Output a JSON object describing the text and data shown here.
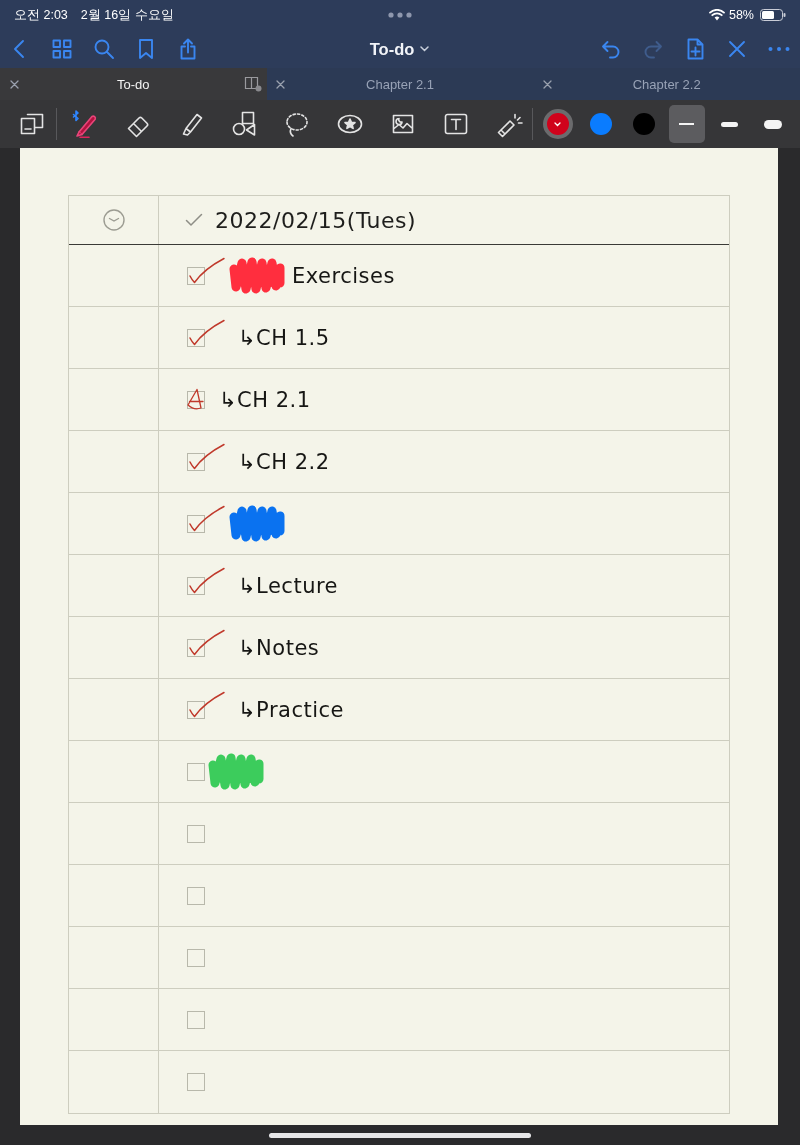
{
  "status_bar": {
    "time": "오전 2:03",
    "date": "2월 16일 수요일",
    "battery": "58%"
  },
  "nav_bar": {
    "left_buttons": [
      {
        "kind": "back",
        "disabled": false
      },
      {
        "kind": "grid",
        "disabled": false
      },
      {
        "kind": "search",
        "disabled": false
      },
      {
        "kind": "bookmark",
        "disabled": false
      },
      {
        "kind": "share",
        "disabled": false
      }
    ],
    "title": "To-do",
    "right_buttons": [
      {
        "kind": "undo",
        "disabled": false
      },
      {
        "kind": "redo",
        "disabled": true
      },
      {
        "kind": "add_page",
        "disabled": false
      },
      {
        "kind": "close",
        "disabled": false
      },
      {
        "kind": "more",
        "disabled": false
      }
    ]
  },
  "tabs": [
    {
      "label": "To-do",
      "selected": true
    },
    {
      "label": "Chapter 2.1",
      "selected": false
    },
    {
      "label": "Chapter 2.2",
      "selected": false
    }
  ],
  "toolbar": {
    "tools": [
      {
        "kind": "layout",
        "selected": false
      },
      {
        "kind": "pen",
        "selected": true
      },
      {
        "kind": "eraser",
        "selected": false
      },
      {
        "kind": "highlighter",
        "selected": false
      },
      {
        "kind": "shapes",
        "selected": false
      },
      {
        "kind": "lasso",
        "selected": false
      },
      {
        "kind": "sticker",
        "selected": false
      },
      {
        "kind": "image",
        "selected": false
      },
      {
        "kind": "text",
        "selected": false
      },
      {
        "kind": "laser",
        "selected": false
      }
    ],
    "colors": [
      {
        "color": "#d0021b",
        "selected": true
      },
      {
        "color": "#0a7cff",
        "selected": false
      },
      {
        "color": "#000000",
        "selected": false
      }
    ],
    "widths": [
      {
        "kind": "thin",
        "selected": true
      },
      {
        "kind": "medium",
        "selected": false
      },
      {
        "kind": "thick",
        "selected": false
      }
    ]
  },
  "page": {
    "header": {
      "date": "2022/02/15(Tues)"
    },
    "rows": [
      {
        "checked": true,
        "partial": false,
        "scribble": {
          "color": "#ff2e3e"
        },
        "text": "Exercises"
      },
      {
        "checked": true,
        "partial": false,
        "text": "↳CH 1.5"
      },
      {
        "checked": false,
        "partial": true,
        "text": "↳CH 2.1"
      },
      {
        "checked": true,
        "partial": false,
        "text": "↳CH 2.2"
      },
      {
        "checked": true,
        "partial": false,
        "scribble": {
          "color": "#0a72f0"
        }
      },
      {
        "checked": true,
        "partial": false,
        "text": "↳Lecture"
      },
      {
        "checked": true,
        "partial": false,
        "text": "↳Notes"
      },
      {
        "checked": true,
        "partial": false,
        "text": "↳Practice"
      },
      {
        "checked": false,
        "partial": false,
        "scribble": {
          "color": "#3ccc5c"
        }
      },
      {
        "checked": false,
        "partial": false
      },
      {
        "checked": false,
        "partial": false
      },
      {
        "checked": false,
        "partial": false
      },
      {
        "checked": false,
        "partial": false
      },
      {
        "checked": false,
        "partial": false
      }
    ]
  }
}
